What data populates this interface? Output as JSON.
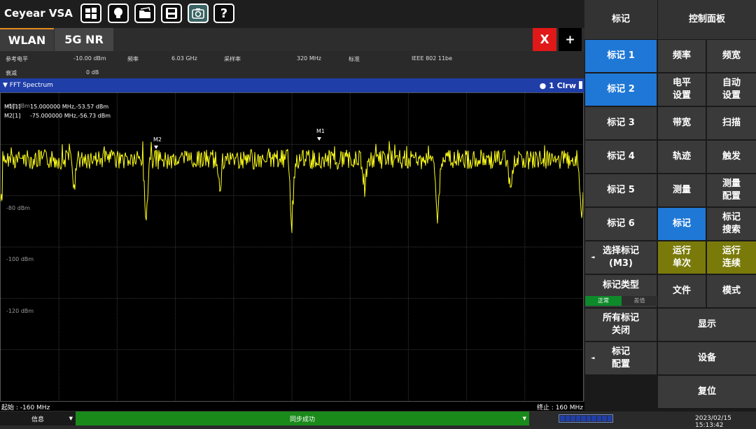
{
  "app": {
    "title": "Ceyear VSA"
  },
  "toolbar": {
    "icons": [
      "windows-icon",
      "lightbulb-icon",
      "folder-icon",
      "save-icon",
      "camera-icon",
      "help-icon"
    ],
    "help_label": "?"
  },
  "tabs": [
    {
      "label": "WLAN"
    },
    {
      "label": "5G NR"
    }
  ],
  "window_buttons": {
    "close": "X",
    "add": "+"
  },
  "params": {
    "ref_level_label": "参考电平",
    "ref_level_value": "-10.00 dBm",
    "freq_label": "频率",
    "freq_value": "6.03 GHz",
    "sample_rate_label": "采样率",
    "sample_rate_value": "320 MHz",
    "standard_label": "标准",
    "standard_value": "IEEE 802 11be",
    "atten_label": "衰减",
    "atten_value": "0 dB"
  },
  "spectrum": {
    "title": "▼ FFT Spectrum",
    "trace": "● 1 Clrw",
    "y_labels": [
      "-60 dBm",
      "-80 dBm",
      "-100 dBm",
      "-120 dBm"
    ],
    "markers_readout": [
      {
        "id": "M1[1]",
        "value": "15.000000 MHz,-53.57 dBm"
      },
      {
        "id": "M2[1]",
        "value": "-75.000000 MHz,-56.73 dBm"
      }
    ],
    "marker_labels": [
      "M1",
      "M2"
    ],
    "start": "起始 : -160 MHz",
    "stop": "终止 : 160 MHz"
  },
  "status": {
    "info": "信息",
    "message": "同步成功",
    "datetime": "2023/02/15 15:13:42"
  },
  "side_panel": {
    "header_marker": "标记",
    "header_control": "控制面板",
    "markers": [
      "标记 1",
      "标记 2",
      "标记 3",
      "标记 4",
      "标记 5",
      "标记 6"
    ],
    "select_marker": "选择标记\n(M3)",
    "marker_type": "标记类型",
    "marker_type_normal": "正常",
    "marker_type_delta": "差值",
    "all_markers_off": "所有标记\n关闭",
    "marker_config": "标记\n配置",
    "ctrl": {
      "freq": "频率",
      "bw_span": "频宽",
      "level": "电平\n设置",
      "auto": "自动\n设置",
      "bandwidth": "带宽",
      "sweep": "扫描",
      "trace": "轨迹",
      "trigger": "触发",
      "measure": "测量",
      "meas_config": "测量\n配置",
      "marker": "标记",
      "marker_search": "标记\n搜索",
      "run_single": "运行\n单次",
      "run_cont": "运行\n连续",
      "file": "文件",
      "mode": "模式",
      "display": "显示",
      "device": "设备",
      "reset": "复位"
    }
  },
  "colors": {
    "trace": "#ffff1a",
    "accent": "#1f78d6",
    "header": "#1f3ea8",
    "active": "#0d8a2a"
  }
}
